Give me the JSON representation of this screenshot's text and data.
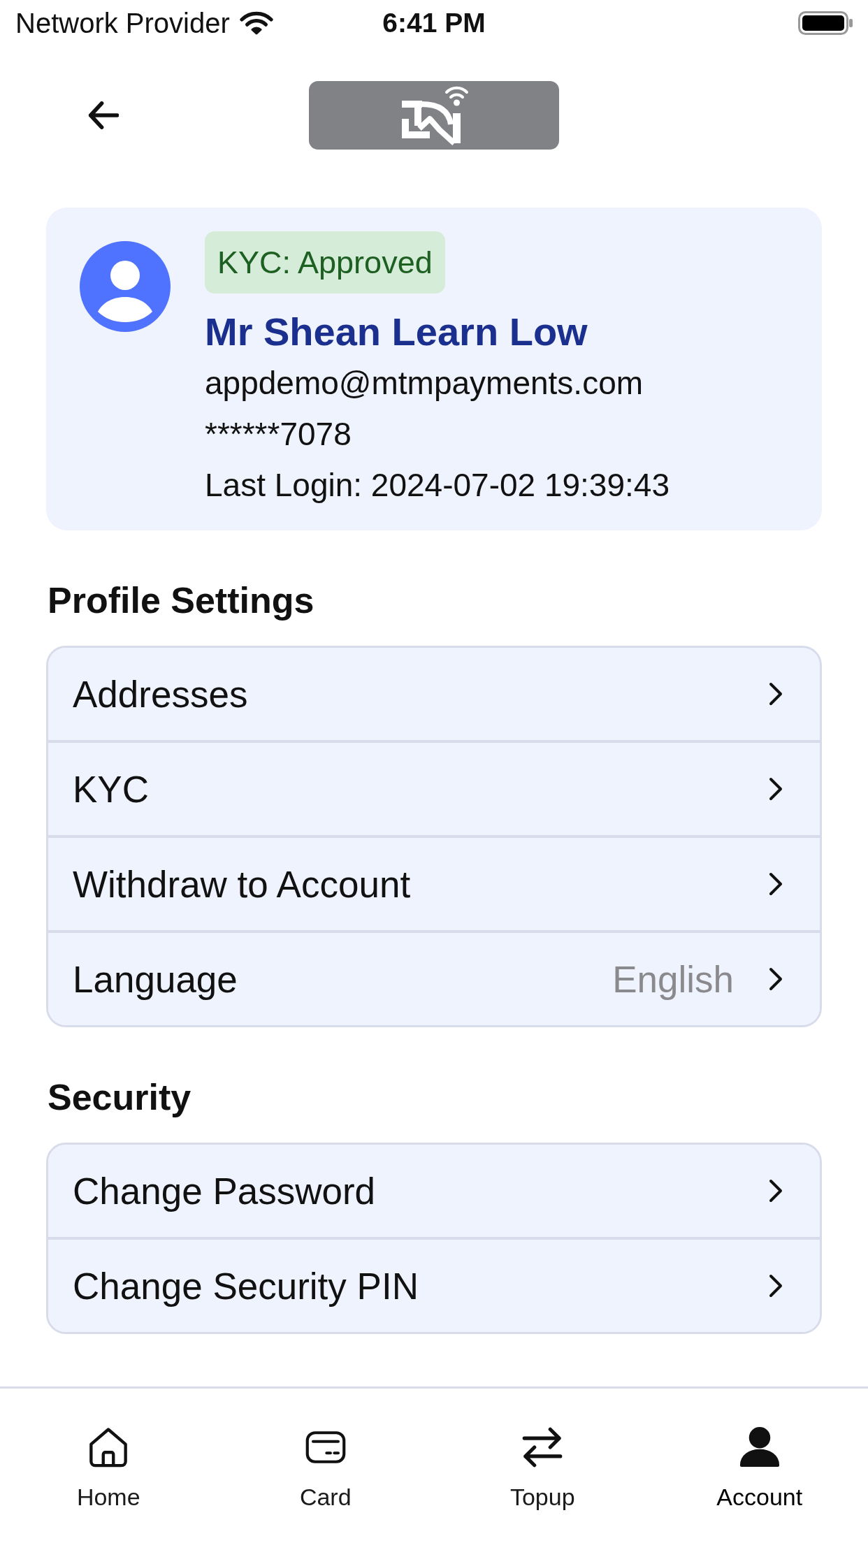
{
  "status_bar": {
    "carrier": "Network Provider",
    "time": "6:41 PM"
  },
  "profile": {
    "kyc_status": "KYC: Approved",
    "name": "Mr Shean Learn Low",
    "email": "appdemo@mtmpayments.com",
    "phone": "******7078",
    "last_login": "Last Login: 2024-07-02 19:39:43"
  },
  "sections": [
    {
      "title": "Profile Settings",
      "items": [
        {
          "label": "Addresses"
        },
        {
          "label": "KYC"
        },
        {
          "label": "Withdraw to Account"
        },
        {
          "label": "Language",
          "value": "English"
        }
      ]
    },
    {
      "title": "Security",
      "items": [
        {
          "label": "Change Password"
        },
        {
          "label": "Change Security PIN"
        }
      ]
    }
  ],
  "tab_bar": [
    {
      "label": "Home",
      "selected": false
    },
    {
      "label": "Card",
      "selected": false
    },
    {
      "label": "Topup",
      "selected": false
    },
    {
      "label": "Account",
      "selected": true
    }
  ]
}
